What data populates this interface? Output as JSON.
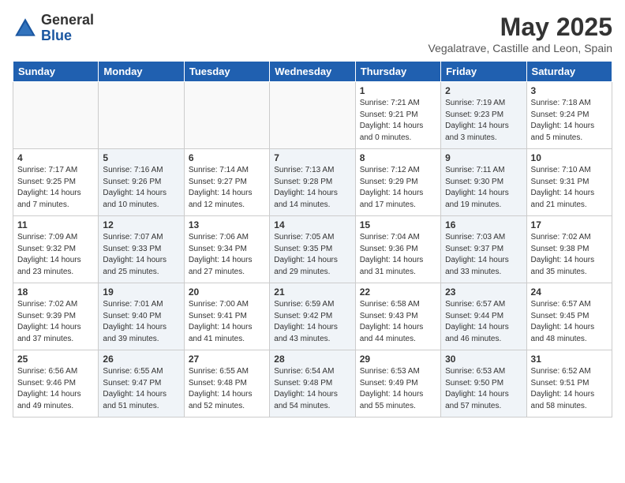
{
  "header": {
    "logo_general": "General",
    "logo_blue": "Blue",
    "month_title": "May 2025",
    "location": "Vegalatrave, Castille and Leon, Spain"
  },
  "days_of_week": [
    "Sunday",
    "Monday",
    "Tuesday",
    "Wednesday",
    "Thursday",
    "Friday",
    "Saturday"
  ],
  "weeks": [
    [
      {
        "num": "",
        "info": "",
        "empty": true
      },
      {
        "num": "",
        "info": "",
        "empty": true
      },
      {
        "num": "",
        "info": "",
        "empty": true
      },
      {
        "num": "",
        "info": "",
        "empty": true
      },
      {
        "num": "1",
        "info": "Sunrise: 7:21 AM\nSunset: 9:21 PM\nDaylight: 14 hours\nand 0 minutes."
      },
      {
        "num": "2",
        "info": "Sunrise: 7:19 AM\nSunset: 9:23 PM\nDaylight: 14 hours\nand 3 minutes.",
        "shaded": true
      },
      {
        "num": "3",
        "info": "Sunrise: 7:18 AM\nSunset: 9:24 PM\nDaylight: 14 hours\nand 5 minutes."
      }
    ],
    [
      {
        "num": "4",
        "info": "Sunrise: 7:17 AM\nSunset: 9:25 PM\nDaylight: 14 hours\nand 7 minutes."
      },
      {
        "num": "5",
        "info": "Sunrise: 7:16 AM\nSunset: 9:26 PM\nDaylight: 14 hours\nand 10 minutes.",
        "shaded": true
      },
      {
        "num": "6",
        "info": "Sunrise: 7:14 AM\nSunset: 9:27 PM\nDaylight: 14 hours\nand 12 minutes."
      },
      {
        "num": "7",
        "info": "Sunrise: 7:13 AM\nSunset: 9:28 PM\nDaylight: 14 hours\nand 14 minutes.",
        "shaded": true
      },
      {
        "num": "8",
        "info": "Sunrise: 7:12 AM\nSunset: 9:29 PM\nDaylight: 14 hours\nand 17 minutes."
      },
      {
        "num": "9",
        "info": "Sunrise: 7:11 AM\nSunset: 9:30 PM\nDaylight: 14 hours\nand 19 minutes.",
        "shaded": true
      },
      {
        "num": "10",
        "info": "Sunrise: 7:10 AM\nSunset: 9:31 PM\nDaylight: 14 hours\nand 21 minutes."
      }
    ],
    [
      {
        "num": "11",
        "info": "Sunrise: 7:09 AM\nSunset: 9:32 PM\nDaylight: 14 hours\nand 23 minutes."
      },
      {
        "num": "12",
        "info": "Sunrise: 7:07 AM\nSunset: 9:33 PM\nDaylight: 14 hours\nand 25 minutes.",
        "shaded": true
      },
      {
        "num": "13",
        "info": "Sunrise: 7:06 AM\nSunset: 9:34 PM\nDaylight: 14 hours\nand 27 minutes."
      },
      {
        "num": "14",
        "info": "Sunrise: 7:05 AM\nSunset: 9:35 PM\nDaylight: 14 hours\nand 29 minutes.",
        "shaded": true
      },
      {
        "num": "15",
        "info": "Sunrise: 7:04 AM\nSunset: 9:36 PM\nDaylight: 14 hours\nand 31 minutes."
      },
      {
        "num": "16",
        "info": "Sunrise: 7:03 AM\nSunset: 9:37 PM\nDaylight: 14 hours\nand 33 minutes.",
        "shaded": true
      },
      {
        "num": "17",
        "info": "Sunrise: 7:02 AM\nSunset: 9:38 PM\nDaylight: 14 hours\nand 35 minutes."
      }
    ],
    [
      {
        "num": "18",
        "info": "Sunrise: 7:02 AM\nSunset: 9:39 PM\nDaylight: 14 hours\nand 37 minutes."
      },
      {
        "num": "19",
        "info": "Sunrise: 7:01 AM\nSunset: 9:40 PM\nDaylight: 14 hours\nand 39 minutes.",
        "shaded": true
      },
      {
        "num": "20",
        "info": "Sunrise: 7:00 AM\nSunset: 9:41 PM\nDaylight: 14 hours\nand 41 minutes."
      },
      {
        "num": "21",
        "info": "Sunrise: 6:59 AM\nSunset: 9:42 PM\nDaylight: 14 hours\nand 43 minutes.",
        "shaded": true
      },
      {
        "num": "22",
        "info": "Sunrise: 6:58 AM\nSunset: 9:43 PM\nDaylight: 14 hours\nand 44 minutes."
      },
      {
        "num": "23",
        "info": "Sunrise: 6:57 AM\nSunset: 9:44 PM\nDaylight: 14 hours\nand 46 minutes.",
        "shaded": true
      },
      {
        "num": "24",
        "info": "Sunrise: 6:57 AM\nSunset: 9:45 PM\nDaylight: 14 hours\nand 48 minutes."
      }
    ],
    [
      {
        "num": "25",
        "info": "Sunrise: 6:56 AM\nSunset: 9:46 PM\nDaylight: 14 hours\nand 49 minutes."
      },
      {
        "num": "26",
        "info": "Sunrise: 6:55 AM\nSunset: 9:47 PM\nDaylight: 14 hours\nand 51 minutes.",
        "shaded": true
      },
      {
        "num": "27",
        "info": "Sunrise: 6:55 AM\nSunset: 9:48 PM\nDaylight: 14 hours\nand 52 minutes."
      },
      {
        "num": "28",
        "info": "Sunrise: 6:54 AM\nSunset: 9:48 PM\nDaylight: 14 hours\nand 54 minutes.",
        "shaded": true
      },
      {
        "num": "29",
        "info": "Sunrise: 6:53 AM\nSunset: 9:49 PM\nDaylight: 14 hours\nand 55 minutes."
      },
      {
        "num": "30",
        "info": "Sunrise: 6:53 AM\nSunset: 9:50 PM\nDaylight: 14 hours\nand 57 minutes.",
        "shaded": true
      },
      {
        "num": "31",
        "info": "Sunrise: 6:52 AM\nSunset: 9:51 PM\nDaylight: 14 hours\nand 58 minutes."
      }
    ]
  ]
}
